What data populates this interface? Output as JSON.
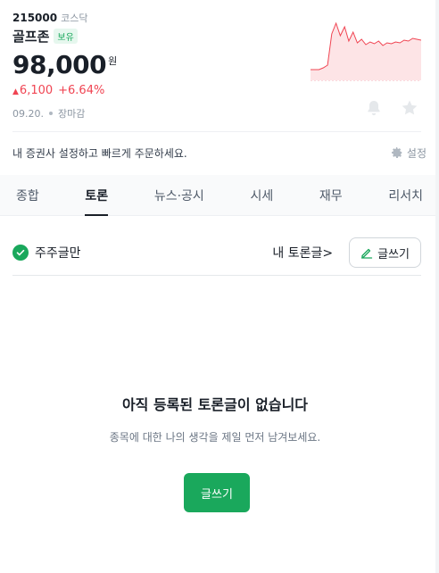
{
  "stock": {
    "code": "215000",
    "market": "코스닥",
    "name": "골프존",
    "hold_badge": "보유",
    "price": "98,000",
    "price_unit": "원",
    "change_amount": "6,100",
    "change_percent": "+6.64%",
    "date": "09.20.",
    "market_status": "장마감"
  },
  "colors": {
    "up": "#f04452",
    "brand_green": "#1aa85c",
    "text_primary": "#191f28",
    "text_secondary": "#8b95a1"
  },
  "icons": {
    "alarm": "bell-icon",
    "favorite": "star-icon",
    "settings": "gear-icon",
    "check": "check-icon",
    "pencil": "pencil-icon"
  },
  "broker": {
    "message": "내 증권사 설정하고 빠르게 주문하세요.",
    "settings_label": "설정"
  },
  "tabs": [
    {
      "label": "종합",
      "active": false
    },
    {
      "label": "토론",
      "active": true
    },
    {
      "label": "뉴스·공시",
      "active": false
    },
    {
      "label": "시세",
      "active": false
    },
    {
      "label": "재무",
      "active": false
    },
    {
      "label": "리서치",
      "active": false
    }
  ],
  "discussion": {
    "filter_label": "주주글만",
    "my_posts_label": "내 토론글>",
    "write_label": "글쓰기",
    "empty_title": "아직 등록된 토론글이 없습니다",
    "empty_desc": "종목에 대한 나의 생각을 제일 먼저 남겨보세요.",
    "cta_label": "글쓰기"
  },
  "mini_chart": {
    "trend": [
      60,
      60,
      60,
      58,
      55,
      20,
      8,
      22,
      12,
      28,
      18,
      30,
      26,
      32,
      29,
      31,
      28,
      33,
      30,
      31,
      29,
      30,
      27,
      28,
      25,
      26,
      27
    ]
  }
}
